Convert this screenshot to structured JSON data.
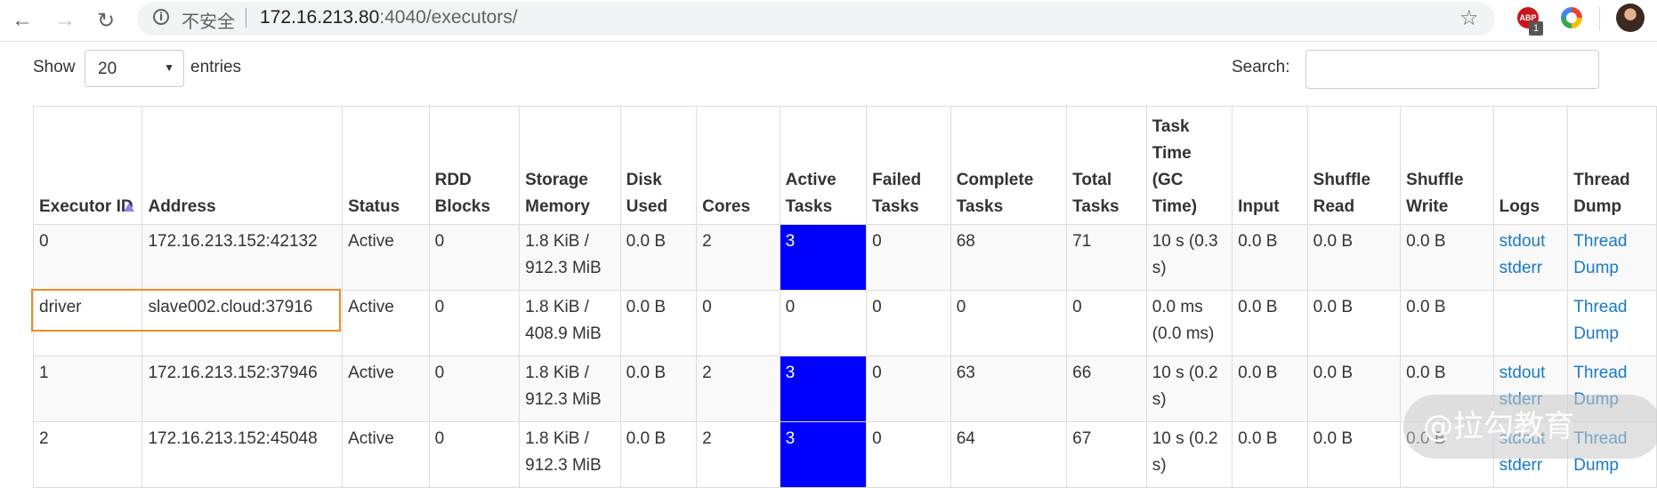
{
  "browser": {
    "security_label": "不安全",
    "url_host": "172.16.213.80",
    "url_rest": ":4040/executors/",
    "abp_label": "ABP",
    "abp_badge": "1"
  },
  "controls": {
    "show_label": "Show",
    "entries_value": "20",
    "entries_label": "entries",
    "search_label": "Search:",
    "search_value": ""
  },
  "table": {
    "headers": [
      "Executor ID",
      "Address",
      "Status",
      "RDD Blocks",
      "Storage Memory",
      "Disk Used",
      "Cores",
      "Active Tasks",
      "Failed Tasks",
      "Complete Tasks",
      "Total Tasks",
      "Task Time (GC Time)",
      "Input",
      "Shuffle Read",
      "Shuffle Write",
      "Logs",
      "Thread Dump"
    ],
    "rows": [
      {
        "id": "0",
        "address": "172.16.213.152:42132",
        "status": "Active",
        "rdd": "0",
        "storage": "1.8 KiB / 912.3 MiB",
        "disk": "0.0 B",
        "cores": "2",
        "active": "3",
        "failed": "0",
        "complete": "68",
        "total": "71",
        "task_time": "10 s (0.3 s)",
        "input": "0.0 B",
        "shuffle_read": "0.0 B",
        "shuffle_write": "0.0 B",
        "log_stdout": "stdout",
        "log_stderr": "stderr",
        "thread_dump": "Thread Dump"
      },
      {
        "id": "driver",
        "address": "slave002.cloud:37916",
        "status": "Active",
        "rdd": "0",
        "storage": "1.8 KiB / 408.9 MiB",
        "disk": "0.0 B",
        "cores": "0",
        "active": "0",
        "failed": "0",
        "complete": "0",
        "total": "0",
        "task_time": "0.0 ms (0.0 ms)",
        "input": "0.0 B",
        "shuffle_read": "0.0 B",
        "shuffle_write": "0.0 B",
        "log_stdout": "",
        "log_stderr": "",
        "thread_dump": "Thread Dump"
      },
      {
        "id": "1",
        "address": "172.16.213.152:37946",
        "status": "Active",
        "rdd": "0",
        "storage": "1.8 KiB / 912.3 MiB",
        "disk": "0.0 B",
        "cores": "2",
        "active": "3",
        "failed": "0",
        "complete": "63",
        "total": "66",
        "task_time": "10 s (0.2 s)",
        "input": "0.0 B",
        "shuffle_read": "0.0 B",
        "shuffle_write": "0.0 B",
        "log_stdout": "stdout",
        "log_stderr": "stderr",
        "thread_dump": "Thread Dump"
      },
      {
        "id": "2",
        "address": "172.16.213.152:45048",
        "status": "Active",
        "rdd": "0",
        "storage": "1.8 KiB / 912.3 MiB",
        "disk": "0.0 B",
        "cores": "2",
        "active": "3",
        "failed": "0",
        "complete": "64",
        "total": "67",
        "task_time": "10 s (0.2 s)",
        "input": "0.0 B",
        "shuffle_read": "0.0 B",
        "shuffle_write": "0.0 B",
        "log_stdout": "stdout",
        "log_stderr": "stderr",
        "thread_dump": "Thread Dump"
      }
    ]
  },
  "colors": {
    "active_tasks_highlight": "#0000ff",
    "link": "#1a7ac4",
    "annotation_box": "#f08a24"
  },
  "watermark": "@拉勾教育"
}
